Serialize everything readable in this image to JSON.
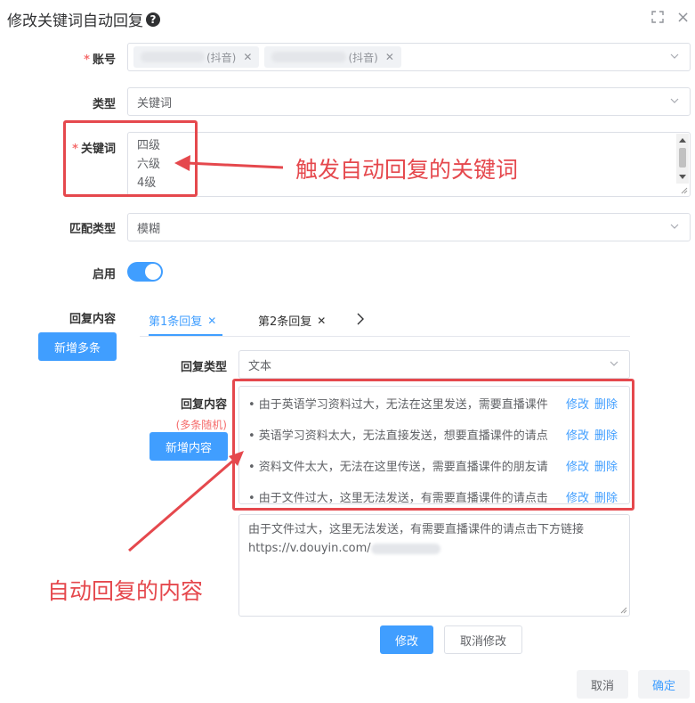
{
  "dialog": {
    "title": "修改关键词自动回复",
    "help_glyph": "?"
  },
  "form": {
    "account": {
      "label": "账号",
      "tags": [
        {
          "suffix": "(抖音)"
        },
        {
          "suffix": "(抖音)"
        }
      ]
    },
    "type": {
      "label": "类型",
      "value": "关键词"
    },
    "keywords": {
      "label": "关键词",
      "lines": [
        "四级",
        "六级",
        "4级"
      ]
    },
    "match_type": {
      "label": "匹配类型",
      "value": "模糊"
    },
    "enabled": {
      "label": "启用",
      "on": true
    },
    "reply_content": {
      "label": "回复内容",
      "add_multi_button": "新增多条"
    }
  },
  "tabs": [
    {
      "label": "第1条回复",
      "active": true
    },
    {
      "label": "第2条回复",
      "active": false
    }
  ],
  "reply": {
    "type_label": "回复类型",
    "type_value": "文本",
    "content_label": "回复内容",
    "random_hint": "(多条随机)",
    "add_content_button": "新增内容",
    "items": [
      {
        "text": "• 由于英语学习资料过大，无法在这里发送，需要直播课件",
        "edit": "修改",
        "delete": "删除"
      },
      {
        "text": "• 英语学习资料太大，无法直接发送，想要直播课件的请点",
        "edit": "修改",
        "delete": "删除"
      },
      {
        "text": "• 资料文件太大，无法在这里传送，需要直播课件的朋友请",
        "edit": "修改",
        "delete": "删除"
      },
      {
        "text": "• 由于文件过大，这里无法发送，有需要直播课件的请点击",
        "edit": "修改",
        "delete": "删除"
      }
    ],
    "edit_text_line1": "由于文件过大，这里无法发送，有需要直播课件的请点击下方链接",
    "edit_text_line2": "https://v.douyin.com/",
    "save_button": "修改",
    "cancel_edit_button": "取消修改"
  },
  "footer": {
    "cancel": "取消",
    "confirm": "确定"
  },
  "annotations": {
    "keyword_note": "触发自动回复的关键词",
    "content_note": "自动回复的内容"
  },
  "colors": {
    "primary": "#409eff",
    "required": "#f56c6c",
    "annotation": "#e5484d"
  }
}
